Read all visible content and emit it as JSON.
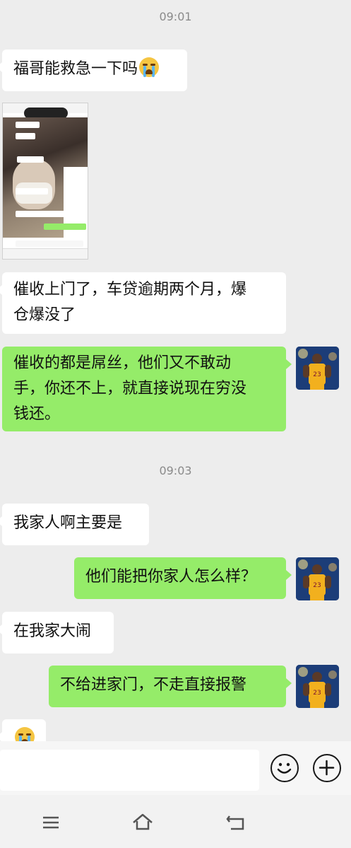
{
  "timestamps": [
    "09:01",
    "09:03"
  ],
  "messages": [
    {
      "side": "in",
      "text": "福哥能救急一下吗"
    },
    {
      "side": "in",
      "type": "image"
    },
    {
      "side": "in",
      "text_line1": "催收上门了，车贷逾期两个月，爆",
      "text_line2": "仓爆没了"
    },
    {
      "side": "out",
      "text_line1": "催收的都是屌丝，他们又不敢动",
      "text_line2": "手，你还不上，就直接说现在穷没",
      "text_line3": "钱还。"
    },
    {
      "side": "in",
      "text": "我家人啊主要是"
    },
    {
      "side": "out",
      "text": "他们能把你家人怎么样？"
    },
    {
      "side": "in",
      "text": "在我家大闹"
    },
    {
      "side": "out",
      "text": "不给进家门，不走直接报警"
    },
    {
      "side": "in",
      "type": "emoji",
      "emoji": "crying-face"
    }
  ],
  "thumbnail_texts": [
    "你回来最讨吧",
    "未应答",
    "不协商处理了?",
    "明天都不能处理?",
    "你全家人都找来了, 你都不",
    "有点用吧, 我",
    "那你今天等那里至少处理逾期两期吧"
  ],
  "colors": {
    "background": "#ededed",
    "incoming": "#ffffff",
    "outgoing": "#95ec69"
  },
  "input": {
    "emoji_icon": "smile-icon",
    "plus_icon": "plus-icon"
  },
  "nav": {
    "menu_icon": "menu-icon",
    "home_icon": "home-icon",
    "back_icon": "back-icon"
  }
}
